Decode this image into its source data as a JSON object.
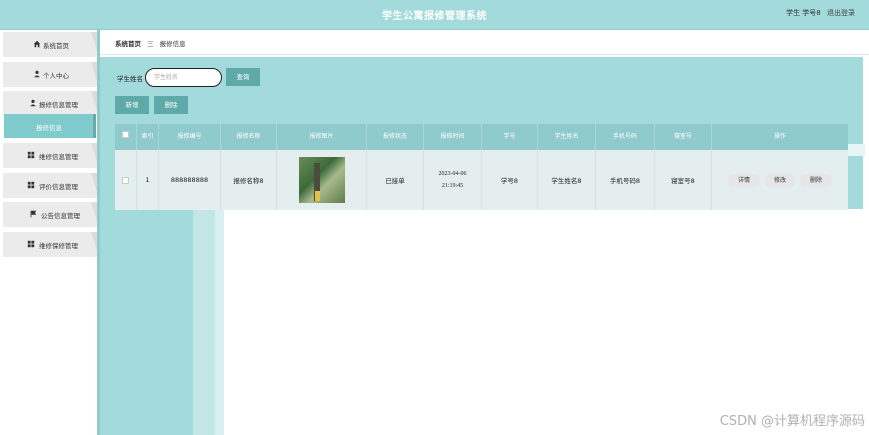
{
  "header": {
    "app_title": "学生公寓报修管理系统",
    "user_label": "学生 学号8",
    "logout_label": "退出登录"
  },
  "sidebar": {
    "items": [
      {
        "label": "系统首页",
        "icon": "home-icon"
      },
      {
        "label": "个人中心",
        "icon": "user-icon"
      },
      {
        "label": "报修信息管理",
        "icon": "user-icon"
      },
      {
        "label": "报修信息",
        "icon": "",
        "active": true
      },
      {
        "label": "维修信息管理",
        "icon": "grid-icon"
      },
      {
        "label": "评价信息管理",
        "icon": "grid-icon"
      },
      {
        "label": "公告信息管理",
        "icon": "flag-icon"
      },
      {
        "label": "维修保修管理",
        "icon": "grid-icon"
      }
    ]
  },
  "breadcrumb": {
    "home": "系统首页",
    "separator": "三",
    "current": "报修信息"
  },
  "search": {
    "label": "学生姓名",
    "placeholder": "学生姓名",
    "button": "查询"
  },
  "toolbar": {
    "add": "新增",
    "delete": "删除"
  },
  "table": {
    "headers": [
      "",
      "索引",
      "报修编号",
      "报修名称",
      "报修图片",
      "报修状态",
      "报修时间",
      "学号",
      "学生姓名",
      "手机号码",
      "寝室号",
      "操作"
    ],
    "rows": [
      {
        "index": "1",
        "repair_no": "888888888",
        "repair_name": "报修名称8",
        "status": "已接单",
        "time": "2023-04-06 21:19:45",
        "student_no": "学号8",
        "student_name": "学生姓名8",
        "phone": "手机号码8",
        "room": "寝室号8",
        "actions": [
          "详情",
          "修改",
          "删除"
        ]
      }
    ]
  },
  "watermark": "CSDN @计算机程序源码",
  "colors": {
    "accent": "#a3dadb",
    "button": "#5eaaa8",
    "header_row": "#8fcacc"
  }
}
